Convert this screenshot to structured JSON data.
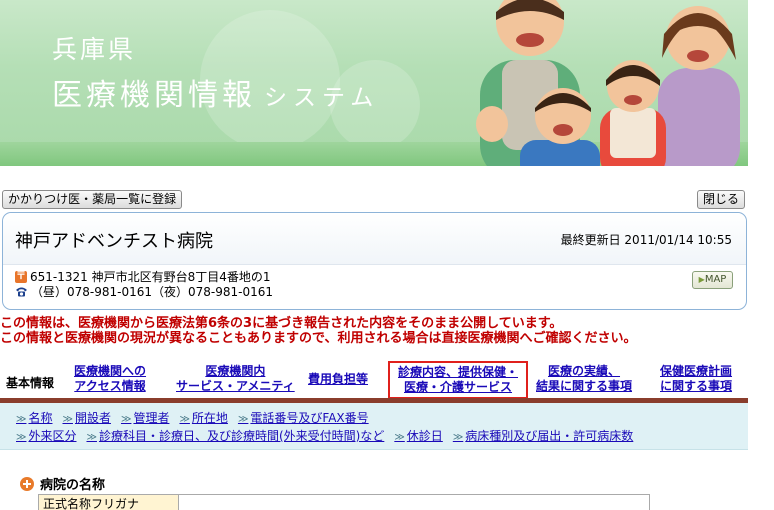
{
  "banner": {
    "prefecture": "兵庫県",
    "system_main": "医療機関情報",
    "system_sub": "システム"
  },
  "buttons": {
    "register": "かかりつけ医・薬局一覧に登録",
    "close": "閉じる",
    "map": "MAP"
  },
  "hospital": {
    "name": "神戸アドベンチスト病院",
    "updated": "最終更新日 2011/01/14 10:55",
    "postal_icon": "〒",
    "address": "651-1321 神戸市北区有野台8丁目4番地の1",
    "phone": "（昼）078-981-0161（夜）078-981-0161"
  },
  "notice": {
    "line1": "この情報は、医療機関から医療法第6条の3に基づき報告された内容をそのまま公開しています。",
    "line2": "この情報と医療機関の現況が異なることもありますので、利用される場合は直接医療機関へご確認ください。"
  },
  "tabs": {
    "basic_label": "基本情報",
    "items": [
      {
        "line1": "医療機関への",
        "line2": "アクセス情報"
      },
      {
        "line1": "医療機関内",
        "line2": "サービス・アメニティ"
      },
      {
        "line1": "費用負担等",
        "line2": ""
      },
      {
        "line1": "診療内容、提供保健・",
        "line2": "医療・介護サービス"
      },
      {
        "line1": "医療の実績、",
        "line2": "結果に関する事項"
      },
      {
        "line1": "保健医療計画",
        "line2": "に関する事項"
      }
    ],
    "selected_index": 3
  },
  "subnav": {
    "row1": [
      "名称",
      "開設者",
      "管理者",
      "所在地",
      "電話番号及びFAX番号"
    ],
    "row2": [
      "外来区分",
      "診療科目・診療日、及び診療時間(外来受付時間)など",
      "休診日",
      "病床種別及び届出・許可病床数"
    ]
  },
  "section": {
    "title": "病院の名称",
    "first_row_header": "正式名称フリガナ"
  },
  "colors": {
    "link": "#1a0ab8",
    "notice": "#c00000",
    "tab_underline": "#8a3d2c",
    "selected_tab_border": "#e0201c",
    "subnav_bg": "#dff1f5"
  }
}
